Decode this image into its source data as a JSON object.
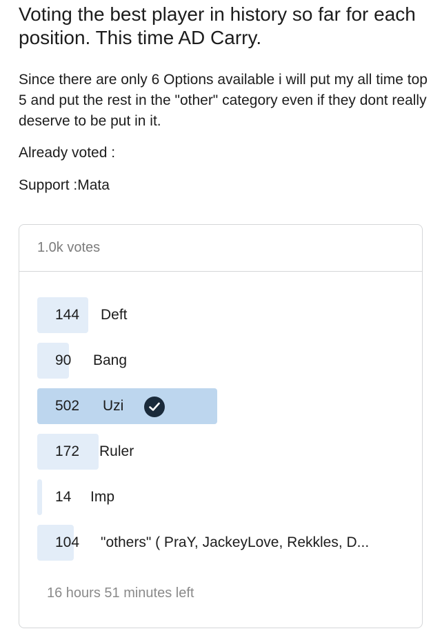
{
  "post": {
    "title": "Voting the best player in history so far for each position. This time AD Carry.",
    "body_paragraph": "Since there are only 6 Options available i will put my all time top 5 and put the rest in the \"other\" category even if they dont really deserve to be put in it.",
    "already_voted": "Already voted :",
    "support_line": "Support :Mata"
  },
  "poll": {
    "total_votes": "1.0k votes",
    "time_left": "16 hours 51 minutes left",
    "accent_color": "#bdd6ee",
    "bar_color": "#e3edf8",
    "options": [
      {
        "count": "144",
        "label": "Deft",
        "votes": 144,
        "selected": false
      },
      {
        "count": "90",
        "label": "Bang",
        "votes": 90,
        "selected": false
      },
      {
        "count": "502",
        "label": "Uzi",
        "votes": 502,
        "selected": true,
        "icon": "checkmark-circle-icon"
      },
      {
        "count": "172",
        "label": "Ruler",
        "votes": 172,
        "selected": false
      },
      {
        "count": "14",
        "label": "Imp",
        "votes": 14,
        "selected": false
      },
      {
        "count": "104",
        "label": "\"others\" ( PraY, JackeyLove, Rekkles, D...",
        "votes": 104,
        "selected": false
      }
    ]
  }
}
